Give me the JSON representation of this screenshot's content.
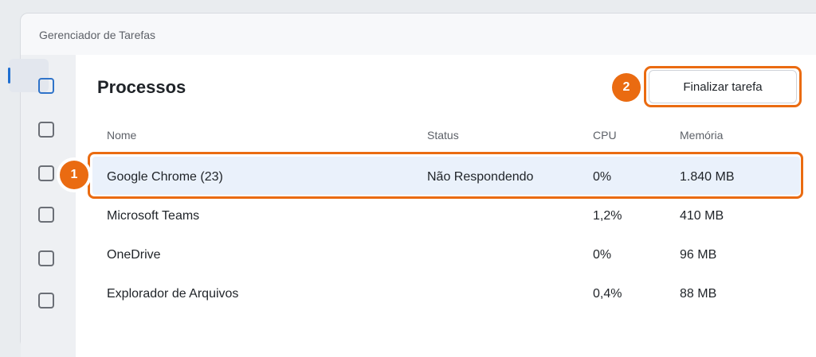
{
  "window": {
    "title": "Gerenciador de Tarefas"
  },
  "sidebar": {
    "items": [
      "processes-icon",
      "performance-icon",
      "history-icon",
      "startup-icon",
      "users-icon",
      "details-icon"
    ]
  },
  "main": {
    "page_title": "Processos",
    "end_task_label": "Finalizar tarefa",
    "columns": {
      "name": "Nome",
      "status": "Status",
      "cpu": "CPU",
      "memory": "Memória"
    },
    "rows": [
      {
        "name": "Google Chrome (23)",
        "status": "Não Respondendo",
        "cpu": "0%",
        "memory": "1.840 MB"
      },
      {
        "name": "Microsoft Teams",
        "status": "",
        "cpu": "1,2%",
        "memory": "410 MB"
      },
      {
        "name": "OneDrive",
        "status": "",
        "cpu": "0%",
        "memory": "96 MB"
      },
      {
        "name": "Explorador de Arquivos",
        "status": "",
        "cpu": "0,4%",
        "memory": "88 MB"
      }
    ]
  },
  "annotations": {
    "step1": "1",
    "step2": "2"
  },
  "colors": {
    "highlight": "#ea6b11",
    "accent": "#1f6fd1",
    "selected_row": "#eaf1fb"
  }
}
